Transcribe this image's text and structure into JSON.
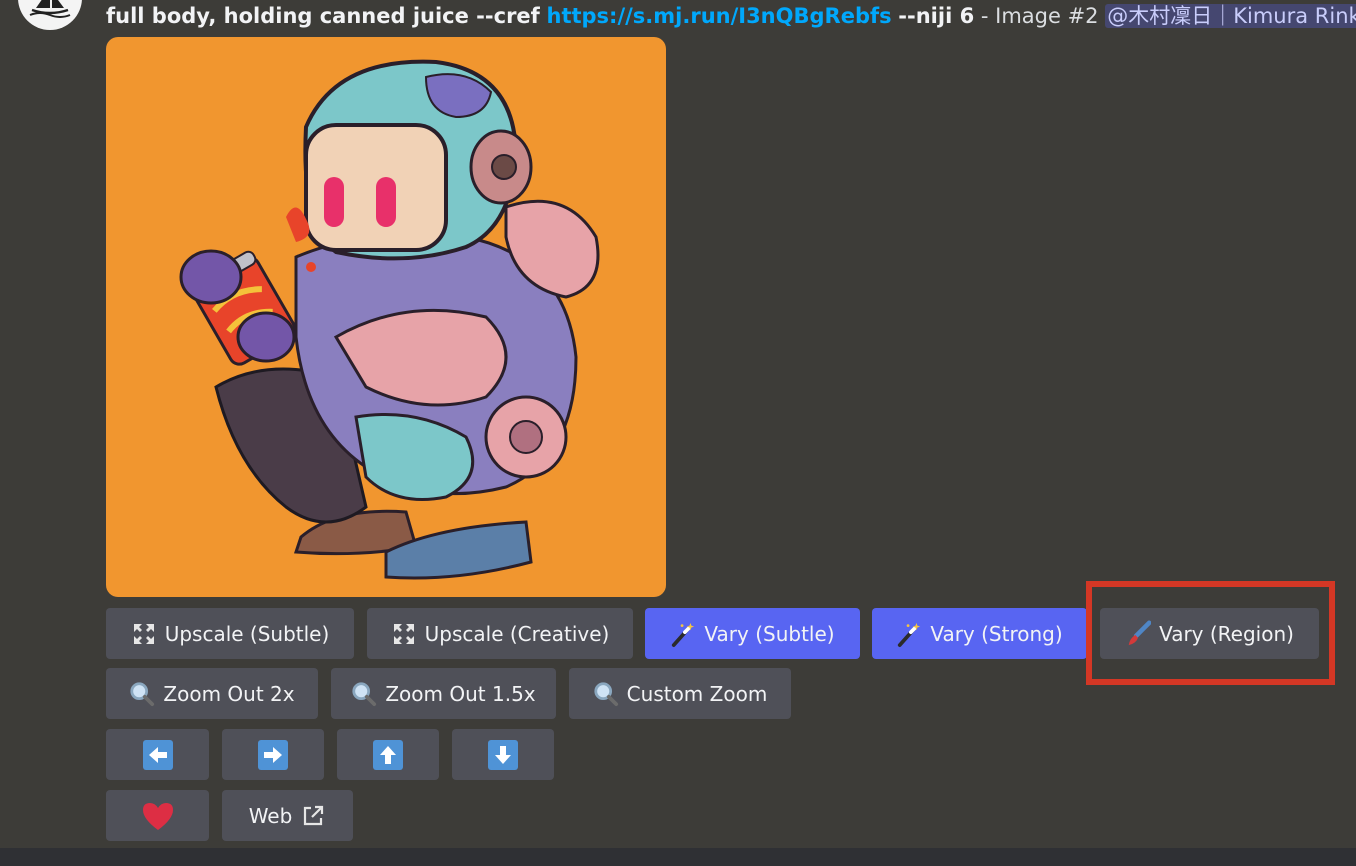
{
  "message": {
    "prompt": "full body, holding canned juice --cref",
    "link": "https://s.mj.run/I3nQBgRebfs",
    "flags": "--niji 6",
    "image_label": "- Image #2",
    "mention": "@木村凜日｜Kimura Rink"
  },
  "buttons": {
    "upscale_subtle": "Upscale (Subtle)",
    "upscale_creative": "Upscale (Creative)",
    "vary_subtle": "Vary (Subtle)",
    "vary_strong": "Vary (Strong)",
    "vary_region": "Vary (Region)",
    "zoom_out_2x": "Zoom Out 2x",
    "zoom_out_15x": "Zoom Out 1.5x",
    "custom_zoom": "Custom Zoom",
    "web": "Web"
  },
  "icons": {
    "upscale": "expand-arrows-icon",
    "vary": "magic-wand-icon",
    "region": "paintbrush-icon",
    "zoom": "magnifier-icon",
    "pan_left": "arrow-left-icon",
    "pan_right": "arrow-right-icon",
    "pan_up": "arrow-up-icon",
    "pan_down": "arrow-down-icon",
    "favorite": "heart-icon",
    "external": "external-link-icon"
  },
  "colors": {
    "background": "#3d3c38",
    "button": "#4f5058",
    "primary_button": "#5865f2",
    "link": "#00a8fc",
    "highlight": "#d43725",
    "image_background": "#f1962f"
  }
}
